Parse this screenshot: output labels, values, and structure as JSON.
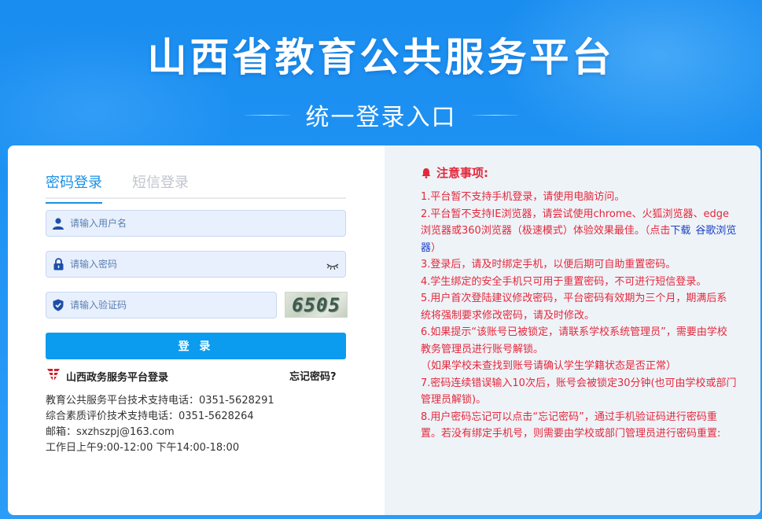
{
  "header": {
    "title": "山西省教育公共服务平台",
    "subtitle": "统一登录入口"
  },
  "login": {
    "tabs": [
      {
        "label": "密码登录",
        "active": true
      },
      {
        "label": "短信登录",
        "active": false
      }
    ],
    "username_placeholder": "请输入用户名",
    "password_placeholder": "请输入密码",
    "captcha_placeholder": "请输入验证码",
    "captcha_text": "6505",
    "login_button": "登 录",
    "gov_login_label": "山西政务服务平台登录",
    "forgot_password": "忘记密码?",
    "support_lines": [
      "教育公共服务平台技术支持电话：0351-5628291",
      "综合素质评价技术支持电话：0351-5628264",
      "邮箱：sxzhszpj@163.com",
      "工作日上午9:00-12:00 下午14:00-18:00"
    ]
  },
  "notice": {
    "title": "注意事项:",
    "items": {
      "i1": "1.平台暂不支持手机登录，请使用电脑访问。",
      "i2_pre": "2.平台暂不支持IE浏览器，请尝试使用chrome、火狐浏览器、edge浏览器或360浏览器（极速模式）体验效果最佳。（点击",
      "i2_link1": "下载",
      "i2_link2": "谷歌浏览器",
      "i2_post": "）",
      "i3": "3.登录后，请及时绑定手机，以便后期可自助重置密码。",
      "i4": "4.学生绑定的安全手机只可用于重置密码，不可进行短信登录。",
      "i5": "5.用户首次登陆建议修改密码，平台密码有效期为三个月，期满后系统将强制要求修改密码，请及时修改。",
      "i6": "6.如果提示“该账号已被锁定，请联系学校系统管理员”，需要由学校教务管理员进行账号解锁。",
      "i6b": "（如果学校未查找到账号请确认学生学籍状态是否正常）",
      "i7": "7.密码连续错误输入10次后，账号会被锁定30分钟(也可由学校或部门管理员解锁)。",
      "i8": "8.用户密码忘记可以点击“忘记密码”，通过手机验证码进行密码重置。若没有绑定手机号，则需要由学校或部门管理员进行密码重置:"
    }
  },
  "colors": {
    "background": "#1f93f3",
    "primary": "#0b9cf0",
    "tab_active": "#1a90e6",
    "notice_red": "#e4283b",
    "link_blue": "#1a3fc4"
  },
  "icons": [
    "user-icon",
    "lock-icon",
    "eye-closed-icon",
    "shield-icon",
    "gov-logo-icon",
    "bell-icon"
  ]
}
